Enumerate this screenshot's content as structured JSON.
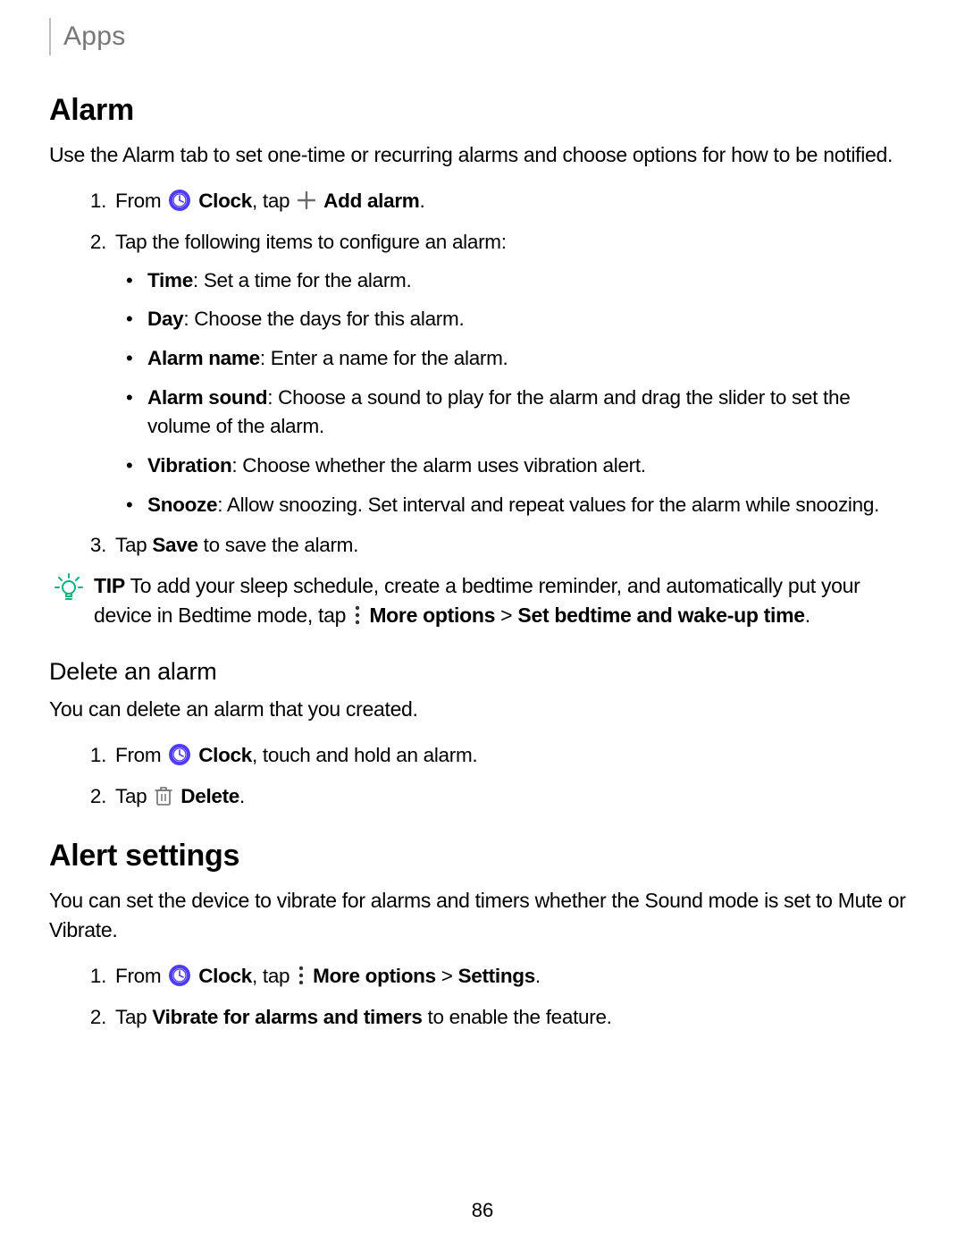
{
  "header": {
    "breadcrumb": "Apps"
  },
  "page_number": "86",
  "alarm": {
    "heading": "Alarm",
    "intro": "Use the Alarm tab to set one-time or recurring alarms and choose options for how to be notified.",
    "step1_pre": "From ",
    "step1_clock": "Clock",
    "step1_mid": ", tap ",
    "step1_add": "Add alarm",
    "step1_post": ".",
    "step2": "Tap the following items to configure an alarm:",
    "bullets": {
      "time": {
        "label": "Time",
        "text": ": Set a time for the alarm."
      },
      "day": {
        "label": "Day",
        "text": ": Choose the days for this alarm."
      },
      "name": {
        "label": "Alarm name",
        "text": ": Enter a name for the alarm."
      },
      "sound": {
        "label": "Alarm sound",
        "text": ": Choose a sound to play for the alarm and drag the slider to set the volume of the alarm."
      },
      "vibration": {
        "label": "Vibration",
        "text": ": Choose whether the alarm uses vibration alert."
      },
      "snooze": {
        "label": "Snooze",
        "text": ": Allow snoozing. Set interval and repeat values for the alarm while snoozing."
      }
    },
    "step3_pre": "Tap ",
    "step3_bold": "Save",
    "step3_post": " to save the alarm."
  },
  "tip": {
    "label": "TIP",
    "text_pre": "  To add your sleep schedule, create a bedtime reminder, and automatically put your device in Bedtime mode, tap ",
    "more_options": "More options",
    "sep": " > ",
    "bedtime": "Set bedtime and wake-up time",
    "text_post": "."
  },
  "delete": {
    "heading": "Delete an alarm",
    "intro": "You can delete an alarm that you created.",
    "step1_pre": "From ",
    "step1_clock": "Clock",
    "step1_post": ", touch and hold an alarm.",
    "step2_pre": "Tap ",
    "step2_delete": "Delete",
    "step2_post": "."
  },
  "alert": {
    "heading": "Alert settings",
    "intro": "You can set the device to vibrate for alarms and timers whether the Sound mode is set to Mute or Vibrate.",
    "step1_pre": "From ",
    "step1_clock": "Clock",
    "step1_mid": ", tap ",
    "step1_more": "More options",
    "step1_sep": " > ",
    "step1_settings": "Settings",
    "step1_post": ".",
    "step2_pre": "Tap ",
    "step2_bold": "Vibrate for alarms and timers",
    "step2_post": " to enable the feature."
  }
}
